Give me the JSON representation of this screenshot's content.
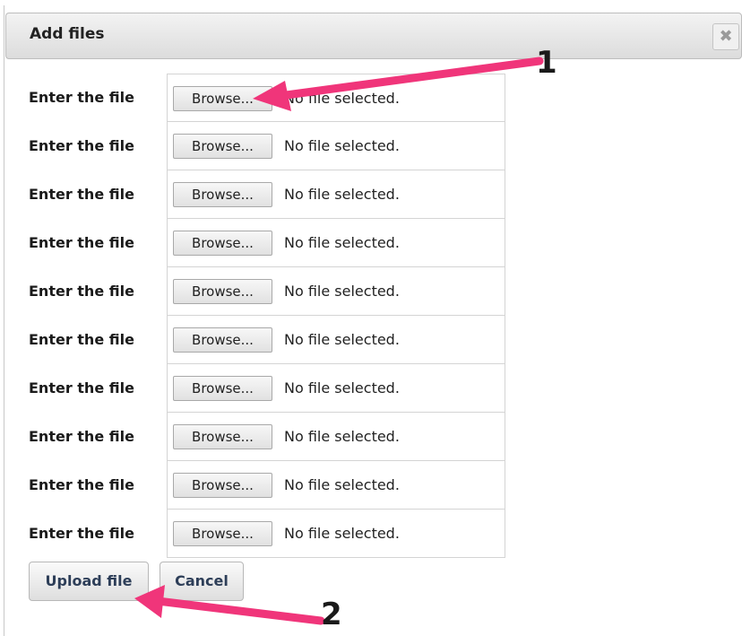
{
  "dialog": {
    "title": "Add files",
    "close_icon": "close-icon"
  },
  "file_rows": [
    {
      "label": "Enter the file",
      "browse_label": "Browse...",
      "status": "No file selected."
    },
    {
      "label": "Enter the file",
      "browse_label": "Browse...",
      "status": "No file selected."
    },
    {
      "label": "Enter the file",
      "browse_label": "Browse...",
      "status": "No file selected."
    },
    {
      "label": "Enter the file",
      "browse_label": "Browse...",
      "status": "No file selected."
    },
    {
      "label": "Enter the file",
      "browse_label": "Browse...",
      "status": "No file selected."
    },
    {
      "label": "Enter the file",
      "browse_label": "Browse...",
      "status": "No file selected."
    },
    {
      "label": "Enter the file",
      "browse_label": "Browse...",
      "status": "No file selected."
    },
    {
      "label": "Enter the file",
      "browse_label": "Browse...",
      "status": "No file selected."
    },
    {
      "label": "Enter the file",
      "browse_label": "Browse...",
      "status": "No file selected."
    },
    {
      "label": "Enter the file",
      "browse_label": "Browse...",
      "status": "No file selected."
    }
  ],
  "actions": {
    "upload_label": "Upload file",
    "cancel_label": "Cancel"
  },
  "annotations": {
    "callout_1": "1",
    "callout_2": "2",
    "arrow_color": "#f0357a"
  }
}
